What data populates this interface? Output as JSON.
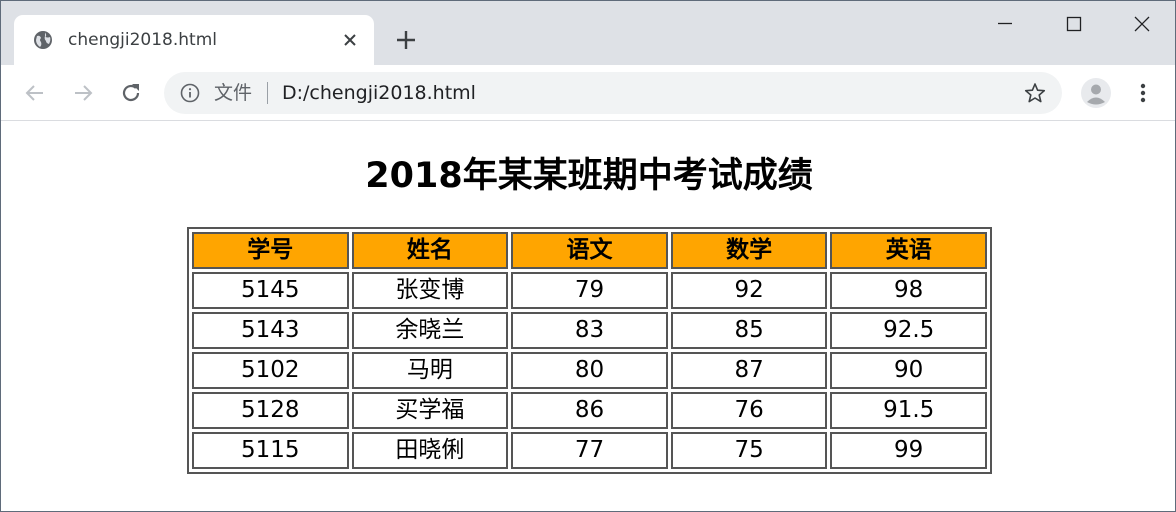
{
  "browser": {
    "tab": {
      "title": "chengji2018.html",
      "favicon": "globe-icon"
    },
    "window_controls": [
      "minimize-icon",
      "maximize-icon",
      "close-icon"
    ],
    "address_bar": {
      "security_label": "文件",
      "url": "D:/chengji2018.html"
    }
  },
  "page": {
    "title": "2018年某某班期中考试成绩",
    "table": {
      "header_bg": "#ffa500",
      "headers": [
        "学号",
        "姓名",
        "语文",
        "数学",
        "英语"
      ],
      "rows": [
        [
          "5145",
          "张变博",
          "79",
          "92",
          "98"
        ],
        [
          "5143",
          "余晓兰",
          "83",
          "85",
          "92.5"
        ],
        [
          "5102",
          "马明",
          "80",
          "87",
          "90"
        ],
        [
          "5128",
          "买学福",
          "86",
          "76",
          "91.5"
        ],
        [
          "5115",
          "田晓俐",
          "77",
          "75",
          "99"
        ]
      ]
    }
  }
}
